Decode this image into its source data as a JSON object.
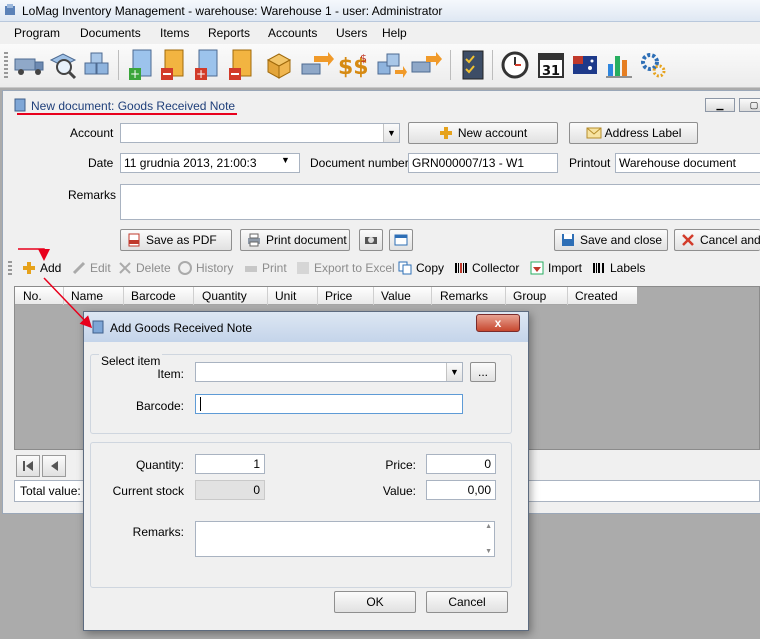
{
  "app": {
    "title": "LoMag Inventory Management - warehouse: Warehouse 1 - user: Administrator"
  },
  "menu": [
    "Program",
    "Documents",
    "Items",
    "Reports",
    "Accounts",
    "Users",
    "Help"
  ],
  "toolbar_icons": [
    "truck-icon",
    "search-warehouse-icon",
    "boxes-icon",
    "add-item-icon",
    "remove-item-icon",
    "add-red-item-icon",
    "remove-orange-item-icon",
    "box-icon",
    "truck-transfer-icon",
    "money-icon",
    "boxes-transfer-icon",
    "truck-forward-icon",
    "checklist-icon",
    "clock-icon",
    "calendar-icon",
    "flag-icon",
    "chart-icon",
    "gears-icon"
  ],
  "calendar_day": "31",
  "document": {
    "title": "New document: Goods Received Note",
    "account_label": "Account",
    "account_value": "",
    "new_account": "New account",
    "address_label": "Address Label",
    "date_label": "Date",
    "date_value": "11   grudnia   2013,  21:00:3",
    "docnum_label": "Document number",
    "docnum_value": "GRN000007/13 - W1",
    "printout_label": "Printout",
    "printout_value": "Warehouse document",
    "remarks_label": "Remarks",
    "remarks_value": "",
    "save_pdf": "Save as PDF",
    "print_document": "Print document",
    "save_close": "Save and close",
    "cancel_close": "Cancel and c"
  },
  "actions": {
    "add": "Add",
    "edit": "Edit",
    "delete": "Delete",
    "history": "History",
    "print": "Print",
    "export": "Export to Excel",
    "copy": "Copy",
    "collector": "Collector",
    "import": "Import",
    "labels": "Labels"
  },
  "grid": {
    "columns": [
      "No.",
      "Name",
      "Barcode",
      "Quantity",
      "Unit",
      "Price",
      "Value",
      "Remarks",
      "Group",
      "Created"
    ]
  },
  "totals": {
    "label": "Total value:"
  },
  "dialog": {
    "title": "Add Goods Received Note",
    "close_glyph": "x",
    "select_group": "Select item",
    "item_label": "Item:",
    "item_value": "",
    "browse": "...",
    "barcode_label": "Barcode:",
    "barcode_value": "",
    "quantity_label": "Quantity:",
    "quantity_value": "1",
    "price_label": "Price:",
    "price_value": "0",
    "stock_label": "Current stock",
    "stock_value": "0",
    "value_label": "Value:",
    "value_value": "0,00",
    "remarks_label": "Remarks:",
    "remarks_value": "",
    "ok": "OK",
    "cancel": "Cancel"
  },
  "colors": {
    "annotation": "#e8001c",
    "title_blue": "#1f3f7a"
  }
}
